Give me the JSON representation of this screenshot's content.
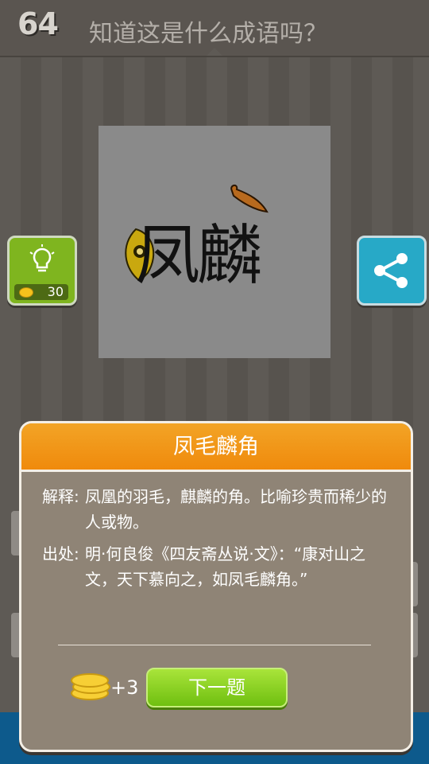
{
  "header": {
    "level": "64",
    "question": "知道这是什么成语吗？"
  },
  "puzzle": {
    "image_text": "凤麟"
  },
  "hint": {
    "icon": "lightbulb-icon",
    "cost": "30"
  },
  "share": {
    "icon": "share-icon"
  },
  "dialog": {
    "title": "凤毛麟角",
    "explanation_label": "解释:",
    "explanation": "凤凰的羽毛，麒麟的角。比喻珍贵而稀少的人或物。",
    "source_label": "出处:",
    "source": "明·何良俊《四友斋丛说·文》：“康对山之文，天下慕向之，如凤毛麟角。”",
    "reward": "+3",
    "next_button": "下一题"
  },
  "colors": {
    "accent_orange": "#f08a0c",
    "button_green": "#7fb51f",
    "share_blue": "#27a9c7",
    "bottom_bar": "#0d5a8c"
  }
}
